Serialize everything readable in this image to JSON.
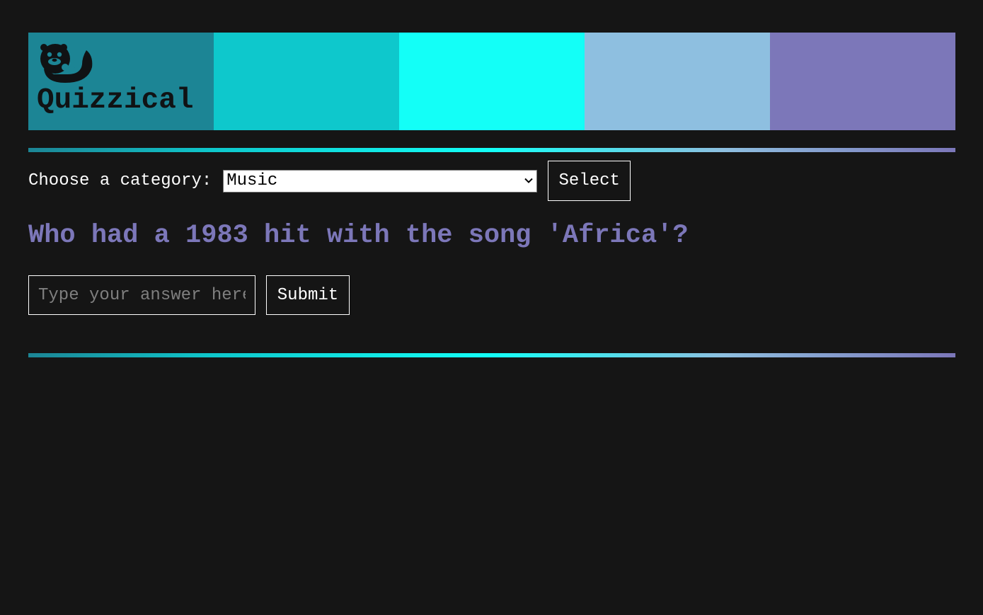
{
  "brand": {
    "name": "Quizzical",
    "logo_icon": "otter-icon"
  },
  "palette": [
    "#1c8595",
    "#0ec8cc",
    "#13fff7",
    "#8ebfe0",
    "#7c77b9"
  ],
  "category": {
    "label": "Choose a category:",
    "selected": "Music",
    "select_button": "Select"
  },
  "question": {
    "text": "Who had a 1983 hit with the song 'Africa'?"
  },
  "answer": {
    "placeholder": "Type your answer here",
    "value": "",
    "submit_button": "Submit"
  }
}
